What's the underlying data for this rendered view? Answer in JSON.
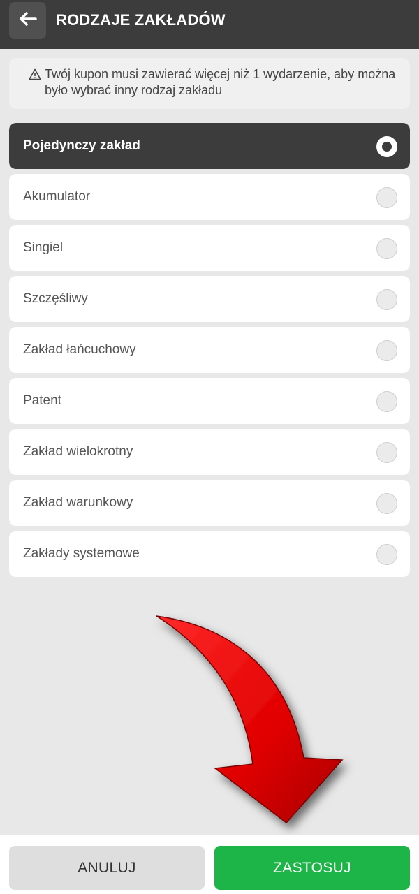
{
  "header": {
    "title": "RODZAJE ZAKŁADÓW",
    "back_icon": "arrow-left-icon"
  },
  "warning": {
    "icon": "warning-triangle-icon",
    "text": "Twój kupon musi zawierać więcej niż 1 wydarzenie, aby można było wybrać inny rodzaj zakładu"
  },
  "options": [
    {
      "label": "Pojedynczy zakład",
      "selected": true
    },
    {
      "label": "Akumulator",
      "selected": false
    },
    {
      "label": "Singiel",
      "selected": false
    },
    {
      "label": "Szczęśliwy",
      "selected": false
    },
    {
      "label": "Zakład łańcuchowy",
      "selected": false
    },
    {
      "label": "Patent",
      "selected": false
    },
    {
      "label": "Zakład wielokrotny",
      "selected": false
    },
    {
      "label": "Zakład warunkowy",
      "selected": false
    },
    {
      "label": "Zakłady systemowe",
      "selected": false
    }
  ],
  "footer": {
    "cancel_label": "ANULUJ",
    "apply_label": "ZASTOSUJ"
  },
  "colors": {
    "header_bg": "#3c3c3c",
    "apply_green": "#1db547",
    "overlay_arrow_red": "#e00000"
  }
}
